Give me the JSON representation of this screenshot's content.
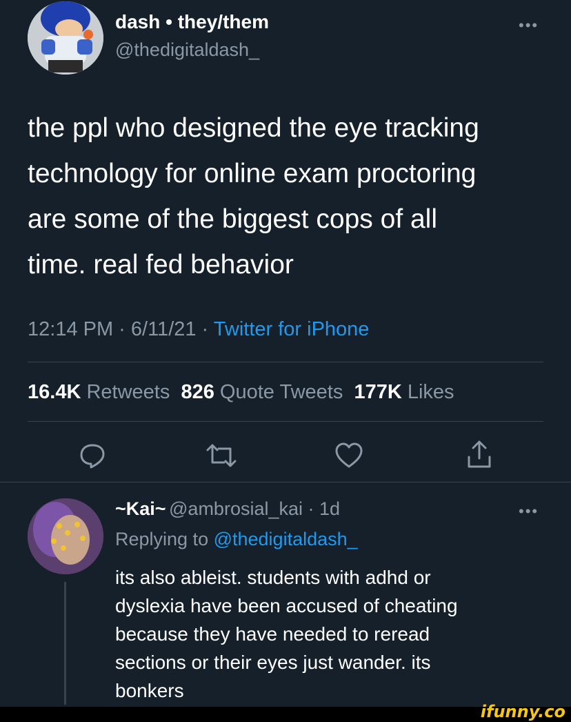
{
  "tweet": {
    "display_name": "dash • they/them",
    "handle": "@thedigitaldash_",
    "text_lines": [
      "the ppl who designed the eye tracking",
      "technology for online exam proctoring",
      "are some of the biggest cops of all",
      "time. real fed behavior"
    ],
    "time": "12:14 PM · 6/11/21 · ",
    "source": "Twitter for iPhone",
    "stats": {
      "retweets_count": "16.4K",
      "retweets_label": "Retweets",
      "quotes_count": "826",
      "quotes_label": "Quote Tweets",
      "likes_count": "177K",
      "likes_label": "Likes"
    },
    "more": "•••"
  },
  "actions": [
    "reply-icon",
    "retweet-icon",
    "like-icon",
    "share-icon"
  ],
  "reply": {
    "display_name": "~Kai~",
    "handle_time": "@ambrosial_kai · 1d",
    "replying_prefix": "Replying to ",
    "replying_handle": "@thedigitaldash_",
    "text_lines": [
      "its also ableist. students with adhd or",
      "dyslexia have been accused of cheating",
      "because they have needed to reread",
      "sections or their eyes just wander. its",
      "bonkers"
    ],
    "more": "•••"
  },
  "watermark": "ifunny.co",
  "colors": {
    "background": "#15202b",
    "accent": "#1d9bf0",
    "muted": "#8b98a5",
    "divider": "#38444d"
  }
}
